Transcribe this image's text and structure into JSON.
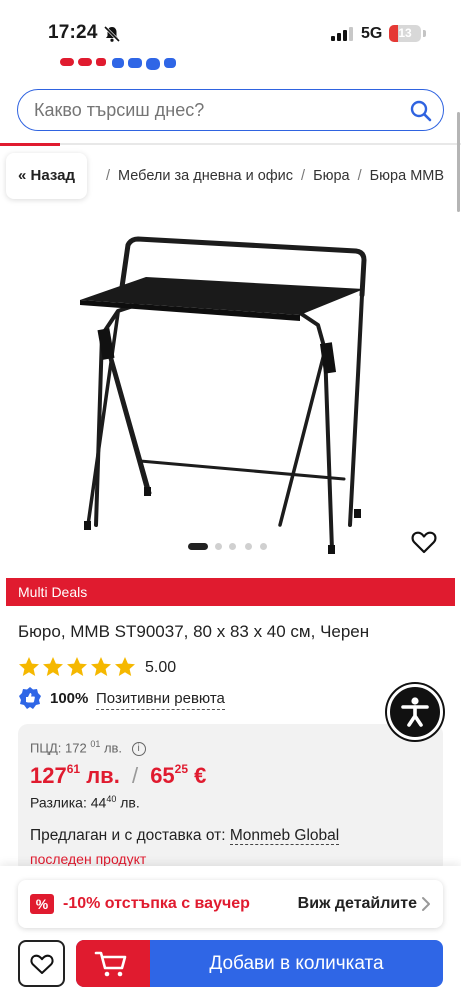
{
  "status_bar": {
    "time": "17:24",
    "network": "5G",
    "battery": "13"
  },
  "search": {
    "placeholder": "Какво търсиш днес?"
  },
  "breadcrumb": {
    "back_label": "« Назад",
    "items": [
      "Мебели за дневна и офис",
      "Бюра",
      "Бюра MMB"
    ],
    "separator": "/"
  },
  "gallery": {
    "slide_count": 5,
    "active_slide": 1
  },
  "banner": {
    "label": "Multi Deals"
  },
  "product": {
    "title": "Бюро, MMB ST90037, 80 x 83 x 40 см, Черен",
    "rating": "5.00",
    "rating_stars": 5,
    "positive_pct": "100%",
    "positive_label": "Позитивни ревюта"
  },
  "pricing": {
    "pcd_label": "ПЦД: 172",
    "pcd_cents": "01",
    "pcd_currency": " лв.",
    "price_bgn": "127",
    "price_bgn_cents": "61",
    "price_bgn_currency": " лв.",
    "price_sep": "/",
    "price_eur": "65",
    "price_eur_cents": "25",
    "price_eur_currency": " €",
    "diff_label": "Разлика: 44",
    "diff_cents": "40",
    "diff_currency": " лв.",
    "seller_label": "Предлаган и с доставка от: ",
    "seller_name": "Monmeb Global",
    "last_product": "последен продукт"
  },
  "voucher": {
    "badge": "%",
    "text": "-10% отстъпка с ваучер",
    "details_label": "Виж детайлите"
  },
  "cart": {
    "add_label": "Добави в количката"
  },
  "colors": {
    "accent_red": "#e01b2f",
    "accent_blue": "#2f66e6",
    "star": "#f5b800"
  }
}
